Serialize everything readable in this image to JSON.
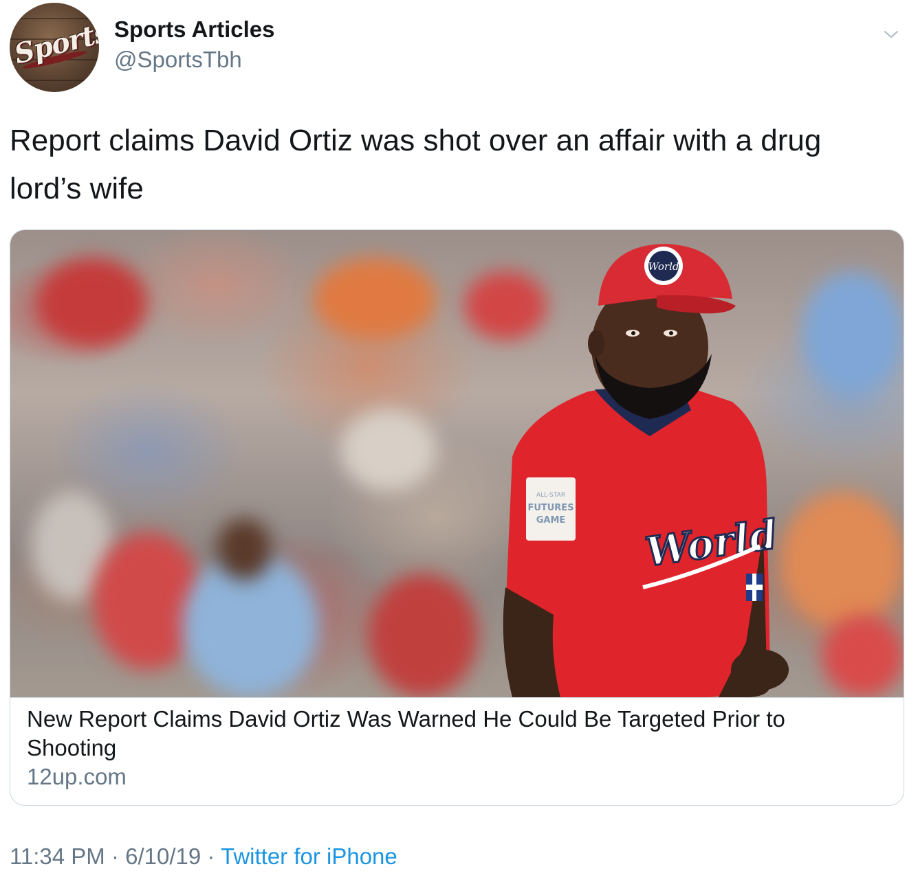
{
  "account": {
    "display_name": "Sports Articles",
    "handle": "@SportsTbh",
    "avatar_text": "Sports"
  },
  "tweet": {
    "text": "Report claims David Ortiz was shot over an affair with a drug lord’s wife"
  },
  "card": {
    "title": "New Report Claims David Ortiz Was Warned He Could Be Targeted Prior to Shooting",
    "domain": "12up.com",
    "image_labels": {
      "cap_text": "World",
      "jersey_text": "World",
      "patch_line1": "ALL-STAR",
      "patch_line2": "FUTURES",
      "patch_line3": "GAME"
    }
  },
  "footer": {
    "time": "11:34 PM",
    "separator1": " · ",
    "date": "6/10/19",
    "separator2": " · ",
    "source": "Twitter for iPhone"
  },
  "colors": {
    "text_primary": "#14171a",
    "text_secondary": "#657786",
    "link": "#1b95e0",
    "border": "#ccd6dd",
    "jersey_red": "#e0242c"
  },
  "icons": {
    "menu": "chevron-down-icon"
  }
}
